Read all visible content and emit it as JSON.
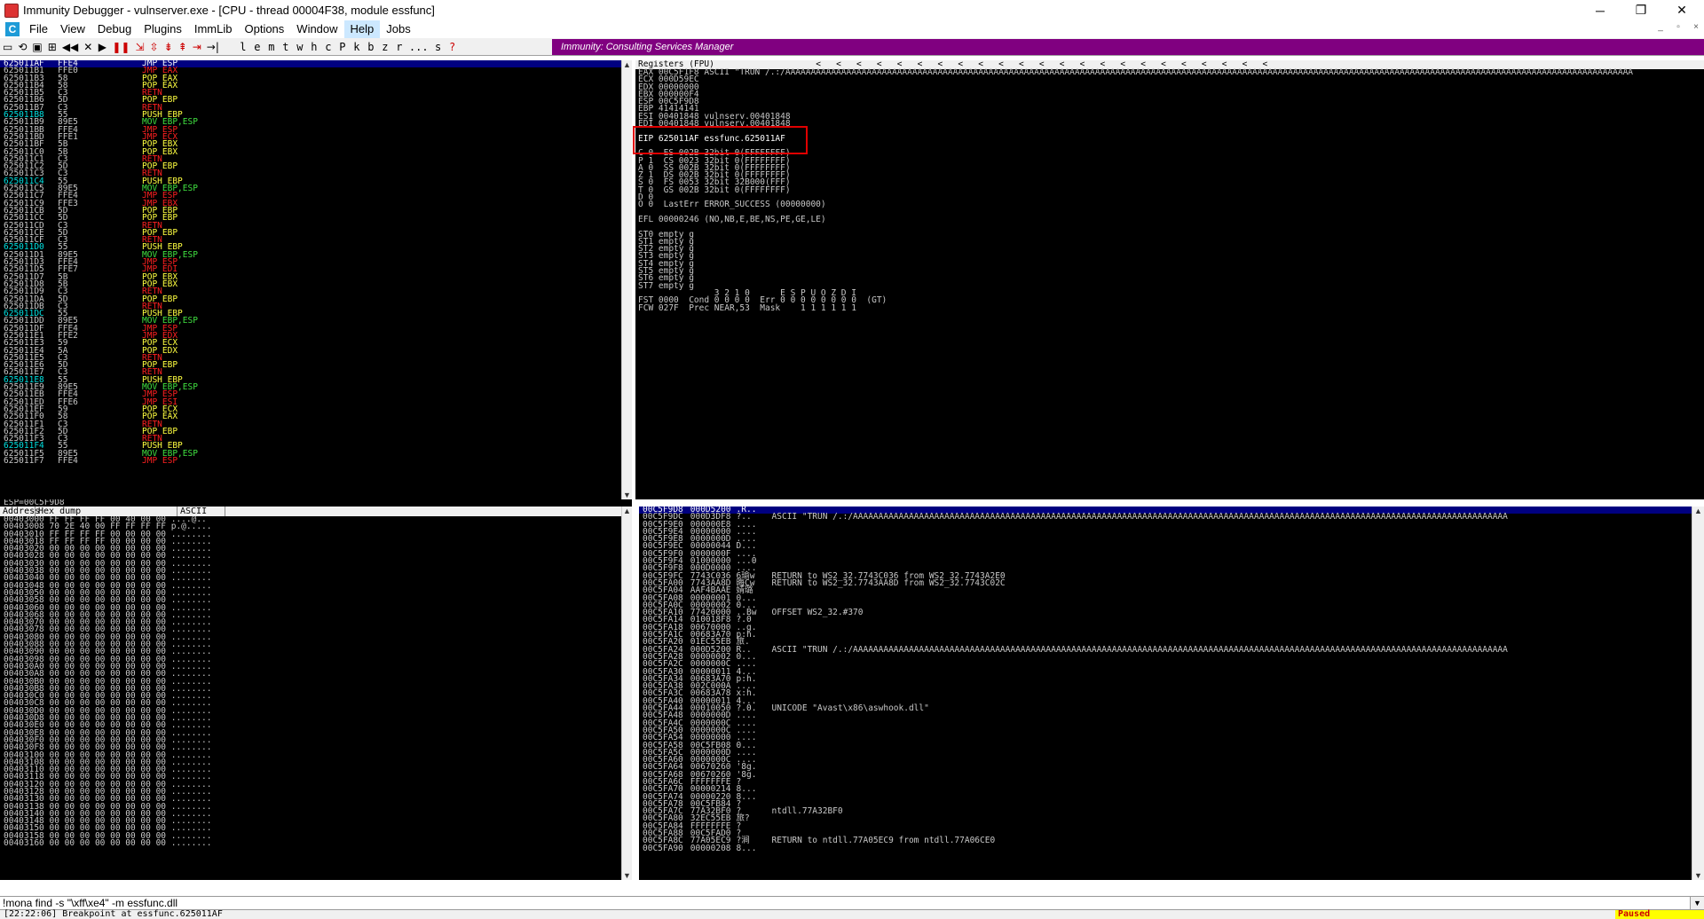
{
  "window": {
    "title": "Immunity Debugger - vulnserver.exe - [CPU - thread 00004F38, module essfunc]",
    "minimize": "─",
    "restore": "❐",
    "close": "✕"
  },
  "menu": {
    "items": [
      "File",
      "View",
      "Debug",
      "Plugins",
      "ImmLib",
      "Options",
      "Window",
      "Help",
      "Jobs"
    ],
    "c_icon": "C",
    "mdi_min": "_",
    "mdi_restore": "▫",
    "mdi_close": "×"
  },
  "toolbar": {
    "buttons": [
      "open-icon",
      "restart-icon",
      "close-icon",
      "attach-icon",
      "rewind-icon",
      "stop-icon",
      "run-icon",
      "pause-icon",
      "step-into-icon",
      "step-over-icon",
      "trace-into-icon",
      "trace-over-icon",
      "execute-till-return-icon",
      "goto-icon"
    ],
    "letters": [
      "l",
      "e",
      "m",
      "t",
      "w",
      "h",
      "c",
      "P",
      "k",
      "b",
      "z",
      "r",
      "...",
      "s",
      "?"
    ],
    "banner": "Immunity: Consulting Services Manager"
  },
  "disasm": {
    "rows": [
      [
        "625011AF",
        "FFE4",
        "JMP ESP",
        "red",
        "sel"
      ],
      [
        "625011B1",
        "FFE0",
        "JMP EAX",
        "red",
        ""
      ],
      [
        "625011B3",
        "58",
        "POP EAX",
        "yel",
        ""
      ],
      [
        "625011B4",
        "58",
        "POP EAX",
        "yel",
        ""
      ],
      [
        "625011B5",
        "C3",
        "RETN",
        "red",
        ""
      ],
      [
        "625011B6",
        "5D",
        "POP EBP",
        "yel",
        ""
      ],
      [
        "625011B7",
        "C3",
        "RETN",
        "red",
        ""
      ],
      [
        "625011B8",
        "55",
        "PUSH EBP",
        "yel",
        "cyan"
      ],
      [
        "625011B9",
        "89E5",
        "MOV EBP,ESP",
        "grn",
        ""
      ],
      [
        "625011BB",
        "FFE4",
        "JMP ESP",
        "red",
        ""
      ],
      [
        "625011BD",
        "FFE1",
        "JMP ECX",
        "red",
        ""
      ],
      [
        "625011BF",
        "5B",
        "POP EBX",
        "yel",
        ""
      ],
      [
        "625011C0",
        "5B",
        "POP EBX",
        "yel",
        ""
      ],
      [
        "625011C1",
        "C3",
        "RETN",
        "red",
        ""
      ],
      [
        "625011C2",
        "5D",
        "POP EBP",
        "yel",
        ""
      ],
      [
        "625011C3",
        "C3",
        "RETN",
        "red",
        ""
      ],
      [
        "625011C4",
        "55",
        "PUSH EBP",
        "yel",
        "cyan"
      ],
      [
        "625011C5",
        "89E5",
        "MOV EBP,ESP",
        "grn",
        ""
      ],
      [
        "625011C7",
        "FFE4",
        "JMP ESP",
        "red",
        ""
      ],
      [
        "625011C9",
        "FFE3",
        "JMP EBX",
        "red",
        ""
      ],
      [
        "625011CB",
        "5D",
        "POP EBP",
        "yel",
        ""
      ],
      [
        "625011CC",
        "5D",
        "POP EBP",
        "yel",
        ""
      ],
      [
        "625011CD",
        "C3",
        "RETN",
        "red",
        ""
      ],
      [
        "625011CE",
        "5D",
        "POP EBP",
        "yel",
        ""
      ],
      [
        "625011CF",
        "C3",
        "RETN",
        "red",
        ""
      ],
      [
        "625011D0",
        "55",
        "PUSH EBP",
        "yel",
        "cyan"
      ],
      [
        "625011D1",
        "89E5",
        "MOV EBP,ESP",
        "grn",
        ""
      ],
      [
        "625011D3",
        "FFE4",
        "JMP ESP",
        "red",
        ""
      ],
      [
        "625011D5",
        "FFE7",
        "JMP EDI",
        "red",
        ""
      ],
      [
        "625011D7",
        "5B",
        "POP EBX",
        "yel",
        ""
      ],
      [
        "625011D8",
        "5B",
        "POP EBX",
        "yel",
        ""
      ],
      [
        "625011D9",
        "C3",
        "RETN",
        "red",
        ""
      ],
      [
        "625011DA",
        "5D",
        "POP EBP",
        "yel",
        ""
      ],
      [
        "625011DB",
        "C3",
        "RETN",
        "red",
        ""
      ],
      [
        "625011DC",
        "55",
        "PUSH EBP",
        "yel",
        "cyan"
      ],
      [
        "625011DD",
        "89E5",
        "MOV EBP,ESP",
        "grn",
        ""
      ],
      [
        "625011DF",
        "FFE4",
        "JMP ESP",
        "red",
        ""
      ],
      [
        "625011E1",
        "FFE2",
        "JMP EDX",
        "red",
        ""
      ],
      [
        "625011E3",
        "59",
        "POP ECX",
        "yel",
        ""
      ],
      [
        "625011E4",
        "5A",
        "POP EDX",
        "yel",
        ""
      ],
      [
        "625011E5",
        "C3",
        "RETN",
        "red",
        ""
      ],
      [
        "625011E6",
        "5D",
        "POP EBP",
        "yel",
        ""
      ],
      [
        "625011E7",
        "C3",
        "RETN",
        "red",
        ""
      ],
      [
        "625011E8",
        "55",
        "PUSH EBP",
        "yel",
        "cyan"
      ],
      [
        "625011E9",
        "89E5",
        "MOV EBP,ESP",
        "grn",
        ""
      ],
      [
        "625011EB",
        "FFE4",
        "JMP ESP",
        "red",
        ""
      ],
      [
        "625011ED",
        "FFE6",
        "JMP ESI",
        "red",
        ""
      ],
      [
        "625011EF",
        "59",
        "POP ECX",
        "yel",
        ""
      ],
      [
        "625011F0",
        "58",
        "POP EAX",
        "yel",
        ""
      ],
      [
        "625011F1",
        "C3",
        "RETN",
        "red",
        ""
      ],
      [
        "625011F2",
        "5D",
        "POP EBP",
        "yel",
        ""
      ],
      [
        "625011F3",
        "C3",
        "RETN",
        "red",
        ""
      ],
      [
        "625011F4",
        "55",
        "PUSH EBP",
        "yel",
        "cyan"
      ],
      [
        "625011F5",
        "89E5",
        "MOV EBP,ESP",
        "grn",
        ""
      ],
      [
        "625011F7",
        "FFE4",
        "JMP ESP",
        "red",
        ""
      ]
    ],
    "footer": "ESP=00C5F9D8"
  },
  "registers": {
    "header": "Registers (FPU)",
    "arrows": "<   <   <   <   <   <   <   <   <   <   <   <   <   <   <   <   <   <   <   <   <   <   <",
    "lines": [
      "EAX 00C5F1F8 ASCII \"TRUN /.:/AAAAAAAAAAAAAAAAAAAAAAAAAAAAAAAAAAAAAAAAAAAAAAAAAAAAAAAAAAAAAAAAAAAAAAAAAAAAAAAAAAAAAAAAAAAAAAAAAAAAAAAAAAAAAAAAAAAAAAAAAAAAAAAAAAAAAAAAAAAAAAAAAAAAAAAAAAAAAAAAAAAAAAA",
      "ECX 000D59EC",
      "EDX 00000000",
      "EBX 000000F4",
      "ESP 00C5F9D8",
      "EBP 41414141",
      "ESI 00401848 vulnserv.00401848",
      "EDI 00401848 vulnserv.00401848",
      "",
      "EIP 625011AF essfunc.625011AF",
      "",
      "C 0  ES 002B 32bit 0(FFFFFFFF)",
      "P 1  CS 0023 32bit 0(FFFFFFFF)",
      "A 0  SS 002B 32bit 0(FFFFFFFF)",
      "Z 1  DS 002B 32bit 0(FFFFFFFF)",
      "S 0  FS 0053 32bit 32B000(FFF)",
      "T 0  GS 002B 32bit 0(FFFFFFFF)",
      "D 0",
      "O 0  LastErr ERROR_SUCCESS (00000000)",
      "",
      "EFL 00000246 (NO,NB,E,BE,NS,PE,GE,LE)",
      "",
      "ST0 empty g",
      "ST1 empty g",
      "ST2 empty g",
      "ST3 empty g",
      "ST4 empty g",
      "ST5 empty g",
      "ST6 empty g",
      "ST7 empty g",
      "               3 2 1 0      E S P U O Z D I",
      "FST 0000  Cond 0 0 0 0  Err 0 0 0 0 0 0 0 0  (GT)",
      "FCW 027F  Prec NEAR,53  Mask    1 1 1 1 1 1"
    ]
  },
  "hexdump": {
    "headers": [
      "Address",
      "Hex dump",
      "ASCII"
    ],
    "rows": [
      "00403000 FF FF FF FF 00 40 00 00 ....@..",
      "00403008 70 2E 40 00 FF FF FF FF p.@.....",
      "00403010 FF FF FF FF 00 00 00 00 ........",
      "00403018 FF FF FF FF 00 00 00 00 ........",
      "00403020 00 00 00 00 00 00 00 00 ........",
      "00403028 00 00 00 00 00 00 00 00 ........",
      "00403030 00 00 00 00 00 00 00 00 ........",
      "00403038 00 00 00 00 00 00 00 00 ........",
      "00403040 00 00 00 00 00 00 00 00 ........",
      "00403048 00 00 00 00 00 00 00 00 ........",
      "00403050 00 00 00 00 00 00 00 00 ........",
      "00403058 00 00 00 00 00 00 00 00 ........",
      "00403060 00 00 00 00 00 00 00 00 ........",
      "00403068 00 00 00 00 00 00 00 00 ........",
      "00403070 00 00 00 00 00 00 00 00 ........",
      "00403078 00 00 00 00 00 00 00 00 ........",
      "00403080 00 00 00 00 00 00 00 00 ........",
      "00403088 00 00 00 00 00 00 00 00 ........",
      "00403090 00 00 00 00 00 00 00 00 ........",
      "00403098 00 00 00 00 00 00 00 00 ........",
      "004030A0 00 00 00 00 00 00 00 00 ........",
      "004030A8 00 00 00 00 00 00 00 00 ........",
      "004030B0 00 00 00 00 00 00 00 00 ........",
      "004030B8 00 00 00 00 00 00 00 00 ........",
      "004030C0 00 00 00 00 00 00 00 00 ........",
      "004030C8 00 00 00 00 00 00 00 00 ........",
      "004030D0 00 00 00 00 00 00 00 00 ........",
      "004030D8 00 00 00 00 00 00 00 00 ........",
      "004030E0 00 00 00 00 00 00 00 00 ........",
      "004030E8 00 00 00 00 00 00 00 00 ........",
      "004030F0 00 00 00 00 00 00 00 00 ........",
      "004030F8 00 00 00 00 00 00 00 00 ........",
      "00403100 00 00 00 00 00 00 00 00 ........",
      "00403108 00 00 00 00 00 00 00 00 ........",
      "00403110 00 00 00 00 00 00 00 00 ........",
      "00403118 00 00 00 00 00 00 00 00 ........",
      "00403120 00 00 00 00 00 00 00 00 ........",
      "00403128 00 00 00 00 00 00 00 00 ........",
      "00403130 00 00 00 00 00 00 00 00 ........",
      "00403138 00 00 00 00 00 00 00 00 ........",
      "00403140 00 00 00 00 00 00 00 00 ........",
      "00403148 00 00 00 00 00 00 00 00 ........",
      "00403150 00 00 00 00 00 00 00 00 ........",
      "00403158 00 00 00 00 00 00 00 00 ........",
      "00403160 00 00 00 00 00 00 00 00 ........"
    ]
  },
  "stack": {
    "rows": [
      [
        "00C5F9D8",
        "000D5200",
        ".R..",
        "",
        "sel"
      ],
      [
        "00C5F9DC",
        "000D3DF8",
        "?..",
        "ASCII \"TRUN /.:/AAAAAAAAAAAAAAAAAAAAAAAAAAAAAAAAAAAAAAAAAAAAAAAAAAAAAAAAAAAAAAAAAAAAAAAAAAAAAAAAAAAAAAAAAAAAAAAAAAAAAAAAAAAAAAAAAAAAAAAAAAAAAAAAA",
        ""
      ],
      [
        "00C5F9E0",
        "000000E8",
        "....",
        "",
        ""
      ],
      [
        "00C5F9E4",
        "00000000",
        "....",
        "",
        ""
      ],
      [
        "00C5F9E8",
        "0000000D",
        "....",
        "",
        ""
      ],
      [
        "00C5F9EC",
        "00000044",
        "D...",
        "",
        ""
      ],
      [
        "00C5F9F0",
        "0000000F",
        "....",
        "",
        ""
      ],
      [
        "00C5F9F4",
        "01000000",
        "...0",
        "",
        ""
      ],
      [
        "00C5F9F8",
        "000D0000",
        "....",
        "",
        ""
      ],
      [
        "00C5F9FC",
        "7743C036",
        "6瑜w",
        "RETURN to WS2_32.7743C036 from WS2_32.7743A2E0",
        ""
      ],
      [
        "00C5FA00",
        "7743AA8D",
        "晦Cw",
        "RETURN to WS2_32.7743AA8D from WS2_32.7743C02C",
        ""
      ],
      [
        "00C5FA04",
        "AAF4BAAE",
        "婧璐",
        "",
        ""
      ],
      [
        "00C5FA08",
        "00000001",
        "0...",
        "",
        ""
      ],
      [
        "00C5FA0C",
        "00000002",
        "0...",
        "",
        ""
      ],
      [
        "00C5FA10",
        "77420000",
        "..Bw",
        "OFFSET WS2_32.#370",
        ""
      ],
      [
        "00C5FA14",
        "010018F8",
        "?.0",
        "",
        ""
      ],
      [
        "00C5FA18",
        "00670000",
        "..g.",
        "",
        ""
      ],
      [
        "00C5FA1C",
        "00683A70",
        "p:h.",
        "",
        ""
      ],
      [
        "00C5FA20",
        "01EC55EB",
        "旅.",
        "",
        ""
      ],
      [
        "00C5FA24",
        "000D5200",
        "R..",
        "ASCII \"TRUN /.:/AAAAAAAAAAAAAAAAAAAAAAAAAAAAAAAAAAAAAAAAAAAAAAAAAAAAAAAAAAAAAAAAAAAAAAAAAAAAAAAAAAAAAAAAAAAAAAAAAAAAAAAAAAAAAAAAAAAAAAAAAAAAAAAAA",
        ""
      ],
      [
        "00C5FA28",
        "00000002",
        "0...",
        "",
        ""
      ],
      [
        "00C5FA2C",
        "0000000C",
        "....",
        "",
        ""
      ],
      [
        "00C5FA30",
        "00000011",
        "4...",
        "",
        ""
      ],
      [
        "00C5FA34",
        "00683A70",
        "p:h.",
        "",
        ""
      ],
      [
        "00C5FA38",
        "002C000A",
        "....",
        "",
        ""
      ],
      [
        "00C5FA3C",
        "00683A78",
        "x:h.",
        "",
        ""
      ],
      [
        "00C5FA40",
        "00000011",
        "4...",
        "",
        ""
      ],
      [
        "00C5FA44",
        "00010050",
        "?.0.",
        "UNICODE \"Avast\\x86\\aswhook.dll\"",
        ""
      ],
      [
        "00C5FA48",
        "0000000D",
        "....",
        "",
        ""
      ],
      [
        "00C5FA4C",
        "0000000C",
        "....",
        "",
        ""
      ],
      [
        "00C5FA50",
        "0000000C",
        "....",
        "",
        ""
      ],
      [
        "00C5FA54",
        "00000000",
        "....",
        "",
        ""
      ],
      [
        "00C5FA58",
        "00C5FB08",
        "0...",
        "",
        ""
      ],
      [
        "00C5FA5C",
        "0000000D",
        "....",
        "",
        ""
      ],
      [
        "00C5FA60",
        "0000000C",
        "....",
        "",
        ""
      ],
      [
        "00C5FA64",
        "00670260",
        "'8g.",
        "",
        ""
      ],
      [
        "00C5FA68",
        "00670260",
        "'8g.",
        "",
        ""
      ],
      [
        "00C5FA6C",
        "FFFFFFFE",
        "?",
        "",
        ""
      ],
      [
        "00C5FA70",
        "00000214",
        "8...",
        "",
        ""
      ],
      [
        "00C5FA74",
        "00000220",
        "8...",
        "",
        ""
      ],
      [
        "00C5FA78",
        "00C5FB84",
        "?",
        "",
        ""
      ],
      [
        "00C5FA7C",
        "77A32BF0",
        "?",
        "ntdll.77A32BF0",
        ""
      ],
      [
        "00C5FA80",
        "32EC55EB",
        "旅?",
        "",
        ""
      ],
      [
        "00C5FA84",
        "FFFFFFFE",
        "?",
        "",
        ""
      ],
      [
        "00C5FA88",
        "00C5FAD0",
        "?",
        "",
        ""
      ],
      [
        "00C5FA8C",
        "77A05EC9",
        "?涧",
        "RETURN to ntdll.77A05EC9 from ntdll.77A06CE0",
        ""
      ],
      [
        "00C5FA90",
        "00000208",
        "8...",
        "",
        ""
      ]
    ]
  },
  "command": {
    "value": "!mona find -s \"\\xff\\xe4\" -m essfunc.dll"
  },
  "status": {
    "message": "[22:22:06] Breakpoint at essfunc.625011AF",
    "state": "Paused"
  },
  "colors": {
    "banner": "#800080",
    "pane_bg": "#000000",
    "highlight_box": "#e00000",
    "paused_bg": "#ffff00"
  }
}
